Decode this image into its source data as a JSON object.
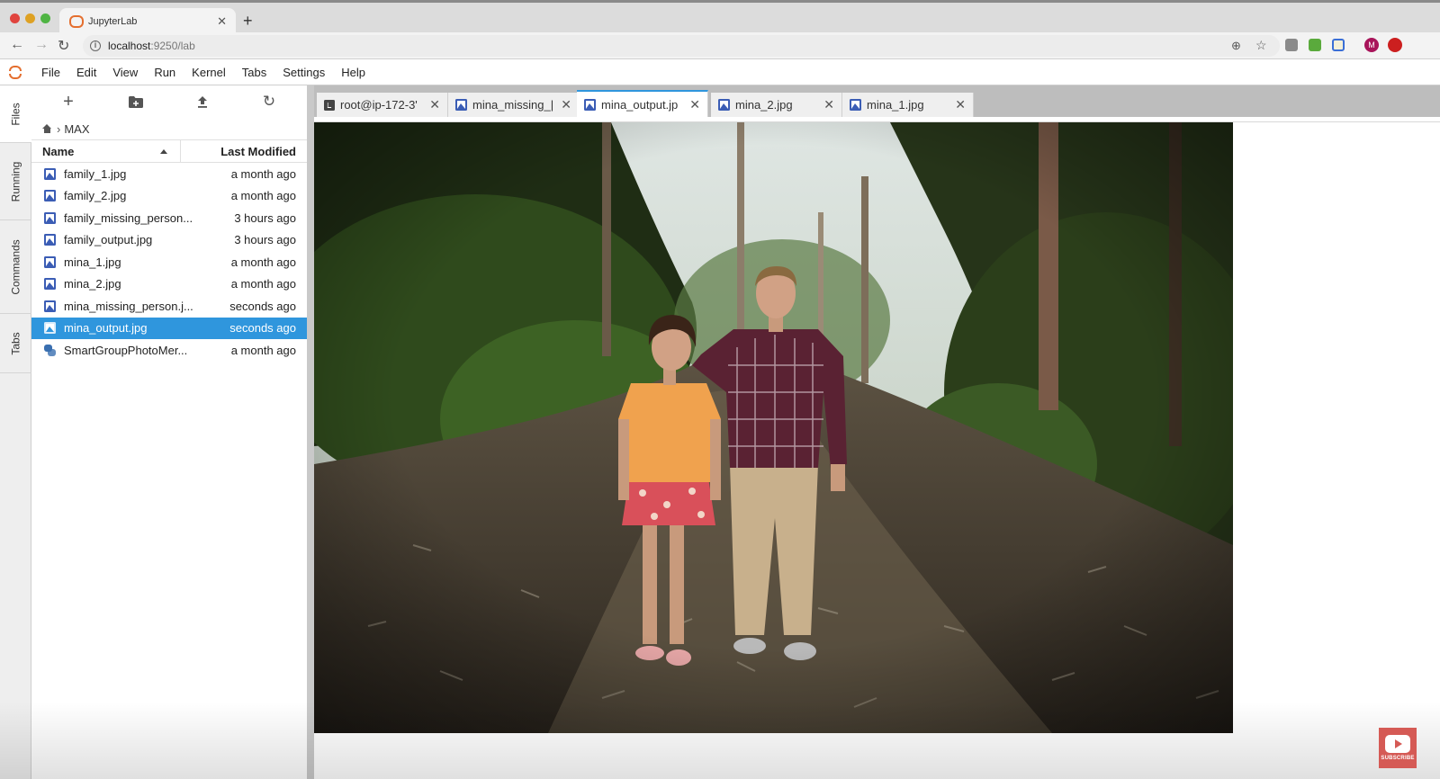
{
  "browser": {
    "tab_title": "JupyterLab",
    "url_host": "localhost",
    "url_path": ":9250/lab",
    "extensions": [
      {
        "name": "zoom-icon",
        "color": "#777777"
      },
      {
        "name": "bookmark-star-icon",
        "color": "#777777"
      },
      {
        "name": "extension-c-icon",
        "color": "#8a8a8a"
      },
      {
        "name": "extension-green-icon",
        "color": "#5aaa3c"
      },
      {
        "name": "extension-puzzle-icon",
        "color": "#3b6fd6"
      },
      {
        "name": "profile-avatar",
        "label": "M",
        "color": "#a8145a"
      },
      {
        "name": "extension-red-icon",
        "color": "#cc1f1f"
      }
    ]
  },
  "menu": {
    "items": [
      "File",
      "Edit",
      "View",
      "Run",
      "Kernel",
      "Tabs",
      "Settings",
      "Help"
    ]
  },
  "activity_tabs": [
    "Files",
    "Running",
    "Commands",
    "Tabs"
  ],
  "filebrowser": {
    "breadcrumb": [
      "MAX"
    ],
    "columns": {
      "name": "Name",
      "modified": "Last Modified"
    },
    "files": [
      {
        "name": "family_1.jpg",
        "modified": "a month ago",
        "type": "image"
      },
      {
        "name": "family_2.jpg",
        "modified": "a month ago",
        "type": "image"
      },
      {
        "name": "family_missing_person...",
        "modified": "3 hours ago",
        "type": "image"
      },
      {
        "name": "family_output.jpg",
        "modified": "3 hours ago",
        "type": "image"
      },
      {
        "name": "mina_1.jpg",
        "modified": "a month ago",
        "type": "image"
      },
      {
        "name": "mina_2.jpg",
        "modified": "a month ago",
        "type": "image"
      },
      {
        "name": "mina_missing_person.j...",
        "modified": "seconds ago",
        "type": "image"
      },
      {
        "name": "mina_output.jpg",
        "modified": "seconds ago",
        "type": "image",
        "selected": true
      },
      {
        "name": "SmartGroupPhotoMer...",
        "modified": "a month ago",
        "type": "python"
      }
    ]
  },
  "doc_tabs": [
    {
      "label": "root@ip-172-3'",
      "icon": "terminal"
    },
    {
      "label": "mina_missing_|",
      "icon": "image"
    },
    {
      "label": "mina_output.jp",
      "icon": "image",
      "active": true
    },
    {
      "label": "mina_2.jpg",
      "icon": "image"
    },
    {
      "label": "mina_1.jpg",
      "icon": "image"
    }
  ],
  "viewer": {
    "file": "mina_output.jpg",
    "description": "Photo of a woman in an orange t-shirt and red patterned skirt and a man in a plaid flannel shirt and khaki pants standing on a leaf-covered forest trail"
  },
  "overlay": {
    "subscribe_label": "SUBSCRIBE"
  },
  "colors": {
    "accent": "#2f96dd",
    "jupyter_orange": "#e46e2e",
    "image_icon": "#3b5db5"
  }
}
